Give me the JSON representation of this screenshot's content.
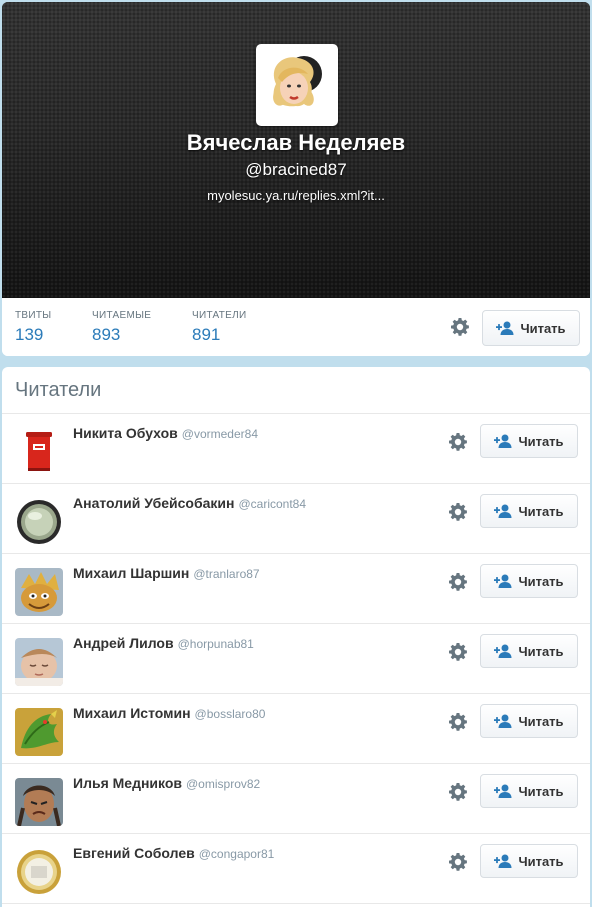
{
  "profile": {
    "name": "Вячеслав Неделяев",
    "handle": "@bracined87",
    "url": "myolesuc.ya.ru/replies.xml?it..."
  },
  "stats": {
    "tweets_label": "ТВИТЫ",
    "tweets_value": "139",
    "following_label": "ЧИТАЕМЫЕ",
    "following_value": "893",
    "followers_label": "ЧИТАТЕЛИ",
    "followers_value": "891"
  },
  "follow_label": "Читать",
  "list": {
    "title": "Читатели",
    "items": [
      {
        "name": "Никита Обухов",
        "handle": "@vormeder84",
        "avatar": "red-mailbox"
      },
      {
        "name": "Анатолий Убейсобакин",
        "handle": "@caricont84",
        "avatar": "round-button"
      },
      {
        "name": "Михаил Шаршин",
        "handle": "@tranlaro87",
        "avatar": "cartoon-character"
      },
      {
        "name": "Андрей Лилов",
        "handle": "@horpunab81",
        "avatar": "sleeping-child"
      },
      {
        "name": "Михаил Истомин",
        "handle": "@bosslaro80",
        "avatar": "green-dragon"
      },
      {
        "name": "Илья Медников",
        "handle": "@omisprov82",
        "avatar": "fantasy-warrior"
      },
      {
        "name": "Евгений Соболев",
        "handle": "@congapor81",
        "avatar": "gold-ring"
      }
    ]
  },
  "colors": {
    "background": "#c0deed",
    "link": "#2b7bb9",
    "follow_icon": "#2b7bb9"
  }
}
